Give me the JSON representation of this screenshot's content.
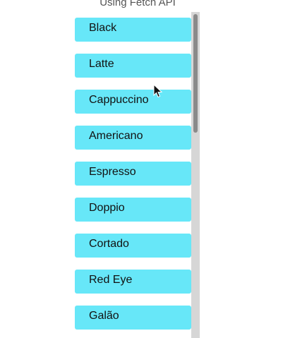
{
  "header": {
    "title": "Using Fetch API"
  },
  "coffee_list": {
    "items": [
      {
        "label": "Black"
      },
      {
        "label": "Latte"
      },
      {
        "label": "Cappuccino"
      },
      {
        "label": "Americano"
      },
      {
        "label": "Espresso"
      },
      {
        "label": "Doppio"
      },
      {
        "label": "Cortado"
      },
      {
        "label": "Red Eye"
      },
      {
        "label": "Galão"
      }
    ]
  },
  "icons": {
    "cursor": "mouse-pointer-icon"
  },
  "colors": {
    "item_background": "#67e7f8",
    "scroll_track": "#d6d6d6",
    "scroll_thumb": "#8a8a8a"
  }
}
